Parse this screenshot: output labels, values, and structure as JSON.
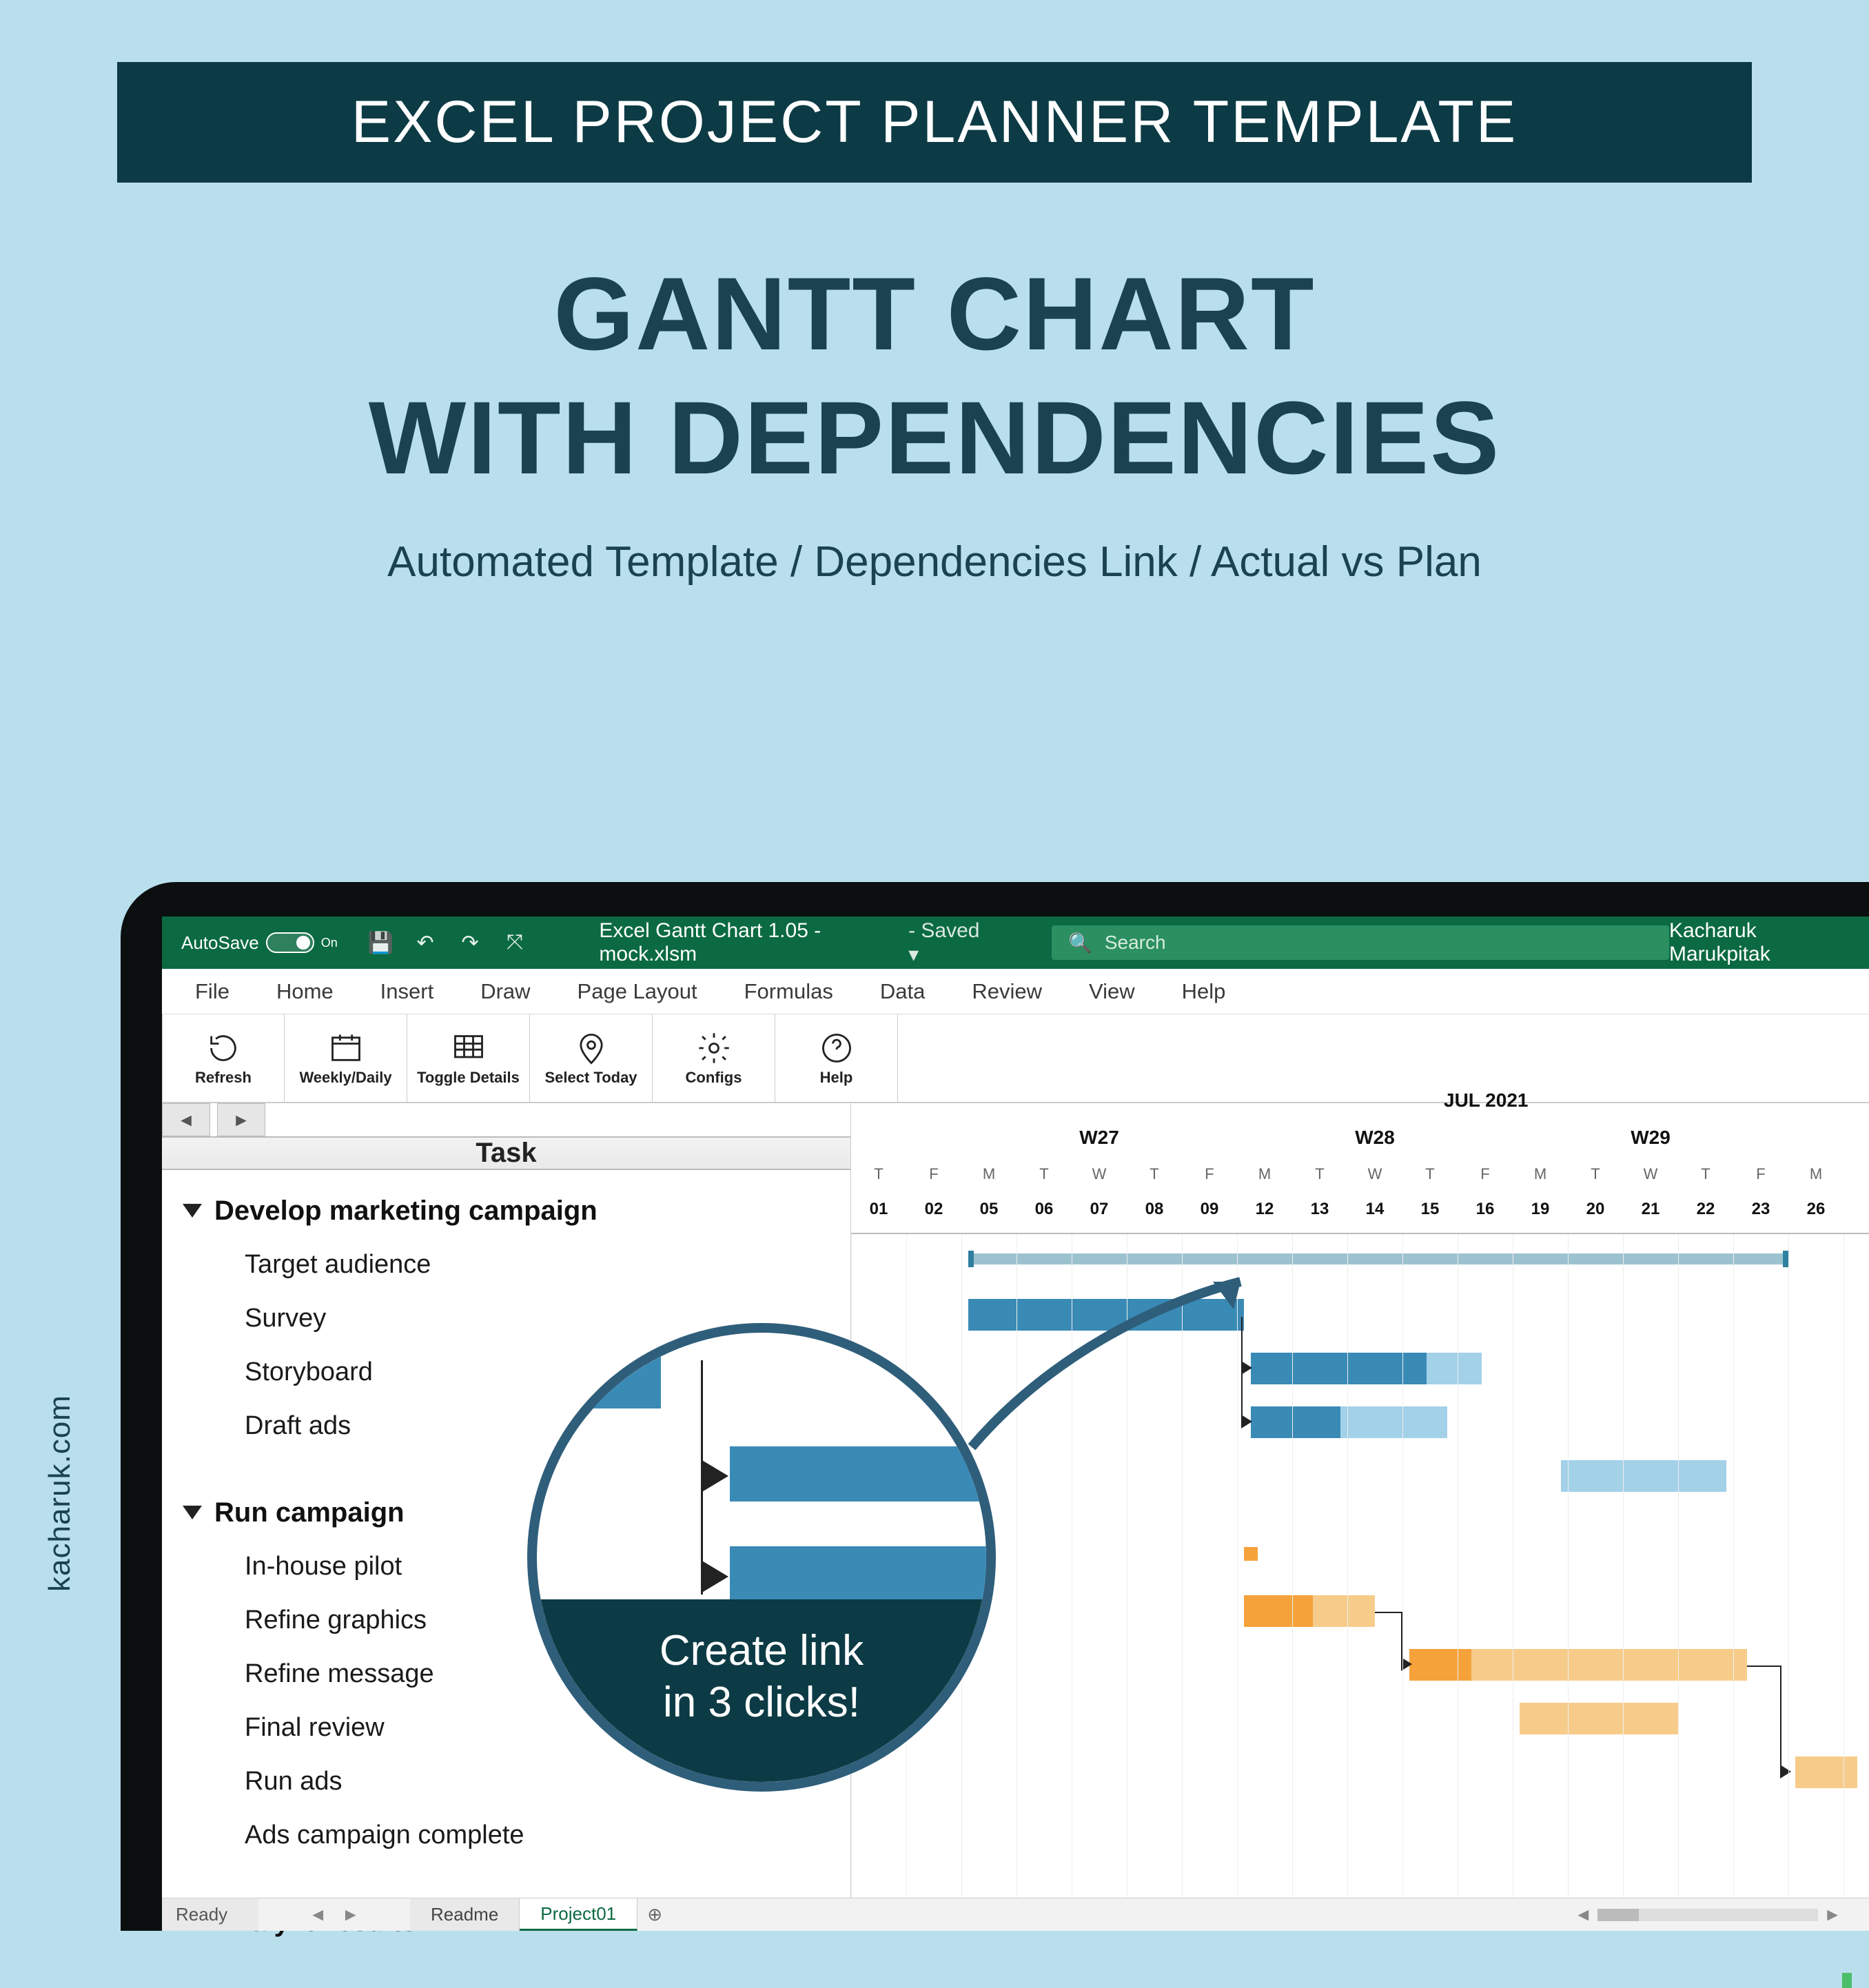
{
  "banner": {
    "label": "EXCEL PROJECT PLANNER TEMPLATE"
  },
  "hero": {
    "line1": "GANTT CHART",
    "line2": "WITH DEPENDENCIES",
    "sub": "Automated Template / Dependencies Link / Actual vs Plan"
  },
  "brand": "kacharuk.com",
  "excel": {
    "autosave": "AutoSave",
    "autosave_state": "On",
    "filename": "Excel Gantt Chart 1.05 - mock.xlsm",
    "saved": "Saved",
    "search_placeholder": "Search",
    "user": "Kacharuk Marukpitak",
    "tabs": [
      "File",
      "Home",
      "Insert",
      "Draw",
      "Page Layout",
      "Formulas",
      "Data",
      "Review",
      "View",
      "Help"
    ]
  },
  "toolbar": [
    {
      "id": "refresh",
      "label": "Refresh"
    },
    {
      "id": "weekly",
      "label": "Weekly/Daily"
    },
    {
      "id": "toggle",
      "label": "Toggle Details"
    },
    {
      "id": "today",
      "label": "Select Today"
    },
    {
      "id": "configs",
      "label": "Configs"
    },
    {
      "id": "help",
      "label": "Help"
    }
  ],
  "task_header": "Task",
  "tasks": {
    "g1": {
      "name": "Develop marketing campaign",
      "items": [
        "Target audience",
        "Survey",
        "Storyboard",
        "Draft ads"
      ]
    },
    "g2": {
      "name": "Run campaign",
      "items": [
        "In-house pilot",
        "Refine graphics",
        "Refine message",
        "Final review",
        "Run ads",
        "Ads campaign complete"
      ]
    },
    "g3": {
      "name": "Analyze results"
    }
  },
  "timeline": {
    "month": "JUL 2021",
    "weeks": [
      "W27",
      "W28",
      "W29"
    ],
    "dows": [
      "T",
      "F",
      "M",
      "T",
      "W",
      "T",
      "F",
      "M",
      "T",
      "W",
      "T",
      "F",
      "M",
      "T",
      "W",
      "T",
      "F",
      "M"
    ],
    "days": [
      "01",
      "02",
      "05",
      "06",
      "07",
      "08",
      "09",
      "12",
      "13",
      "14",
      "15",
      "16",
      "19",
      "20",
      "21",
      "22",
      "23",
      "26"
    ]
  },
  "sheets": {
    "ready": "Ready",
    "tabs": [
      "Readme",
      "Project01"
    ],
    "active": 1
  },
  "callout": {
    "line1": "Create link",
    "line2": "in 3 clicks!"
  },
  "chart_data": {
    "type": "bar",
    "title": "Gantt chart - JUL 2021",
    "categories": [
      "01",
      "02",
      "05",
      "06",
      "07",
      "08",
      "09",
      "12",
      "13",
      "14",
      "15",
      "16",
      "19",
      "20",
      "21",
      "22",
      "23",
      "26"
    ],
    "series": [
      {
        "name": "Develop marketing campaign (summary)",
        "start": "05",
        "end": "22",
        "color": "#9cc2d0"
      },
      {
        "name": "Target audience",
        "start": "05",
        "end": "09",
        "color": "#3a8ab6"
      },
      {
        "name": "Survey (actual)",
        "start": "12",
        "end": "15",
        "color": "#3a8ab6"
      },
      {
        "name": "Survey (plan)",
        "start": "15",
        "end": "16",
        "color": "#a3d1e8"
      },
      {
        "name": "Storyboard (actual)",
        "start": "12",
        "end": "13",
        "color": "#3a8ab6"
      },
      {
        "name": "Storyboard (plan)",
        "start": "13",
        "end": "15",
        "color": "#a3d1e8"
      },
      {
        "name": "Draft ads",
        "start": "20",
        "end": "22",
        "color": "#a3d1e8"
      },
      {
        "name": "Run campaign (summary)",
        "start": "12",
        "end": "12",
        "color": "#f5a23b"
      },
      {
        "name": "In-house pilot (actual)",
        "start": "12",
        "end": "13",
        "color": "#f5a23b"
      },
      {
        "name": "In-house pilot (plan)",
        "start": "13",
        "end": "14",
        "color": "#f7cc8a"
      },
      {
        "name": "Refine graphics (actual)",
        "start": "15",
        "end": "16",
        "color": "#f5a23b"
      },
      {
        "name": "Refine graphics (plan)",
        "start": "16",
        "end": "22",
        "color": "#f7cc8a"
      },
      {
        "name": "Refine message",
        "start": "19",
        "end": "21",
        "color": "#f7cc8a"
      },
      {
        "name": "Final review",
        "start": "26",
        "end": "26",
        "color": "#f7cc8a"
      }
    ]
  }
}
